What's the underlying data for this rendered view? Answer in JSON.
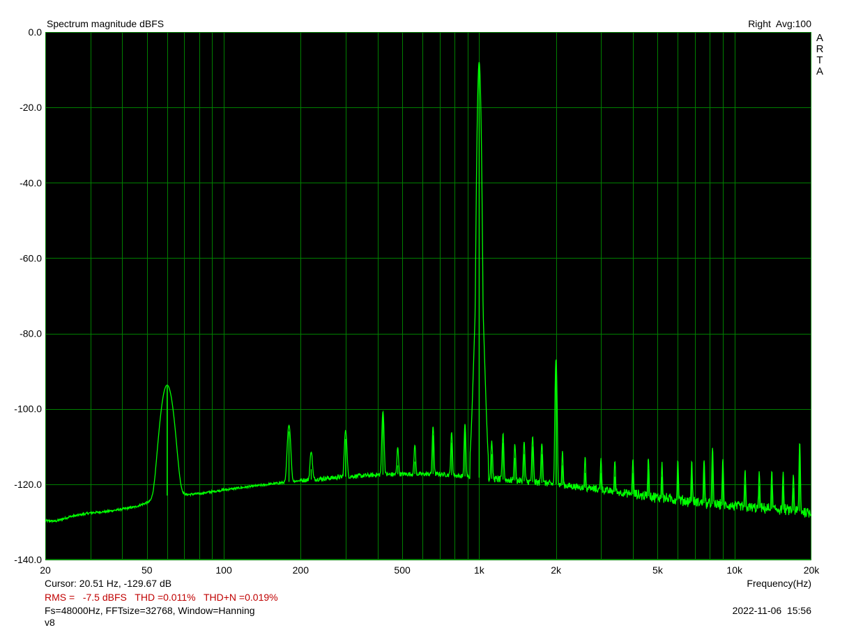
{
  "chart_data": {
    "type": "line",
    "title": "Spectrum magnitude dBFS",
    "channel_info": "Right  Avg:100",
    "logo_letters": [
      "A",
      "R",
      "T",
      "A"
    ],
    "xlabel": "Frequency(Hz)",
    "ylabel": "",
    "x_scale": "log",
    "xlim": [
      20,
      20000
    ],
    "ylim": [
      -140,
      0
    ],
    "x_ticks": [
      {
        "value": 20,
        "label": "20"
      },
      {
        "value": 50,
        "label": "50"
      },
      {
        "value": 100,
        "label": "100"
      },
      {
        "value": 200,
        "label": "200"
      },
      {
        "value": 500,
        "label": "500"
      },
      {
        "value": 1000,
        "label": "1k"
      },
      {
        "value": 2000,
        "label": "2k"
      },
      {
        "value": 5000,
        "label": "5k"
      },
      {
        "value": 10000,
        "label": "10k"
      },
      {
        "value": 20000,
        "label": "20k"
      }
    ],
    "y_ticks": [
      {
        "value": 0,
        "label": "0.0"
      },
      {
        "value": -20,
        "label": "-20.0"
      },
      {
        "value": -40,
        "label": "-40.0"
      },
      {
        "value": -60,
        "label": "-60.0"
      },
      {
        "value": -80,
        "label": "-80.0"
      },
      {
        "value": -100,
        "label": "-100.0"
      },
      {
        "value": -120,
        "label": "-120.0"
      },
      {
        "value": -140,
        "label": "-140.0"
      }
    ],
    "grid": true,
    "background": "#000000",
    "grid_color": "#008000",
    "trace_color": "#00ff00",
    "series": [
      {
        "baseline": [
          [
            20,
            -129.7
          ],
          [
            22,
            -129.8
          ],
          [
            25,
            -128.6
          ],
          [
            30,
            -127.6
          ],
          [
            35,
            -127.2
          ],
          [
            40,
            -126.6
          ],
          [
            45,
            -126.0
          ],
          [
            50,
            -124.9
          ],
          [
            55,
            -124.6
          ],
          [
            57,
            -124.4
          ],
          [
            58,
            -123.0
          ],
          [
            63,
            -123.0
          ],
          [
            70,
            -122.8
          ],
          [
            80,
            -122.5
          ],
          [
            100,
            -121.5
          ],
          [
            150,
            -120.0
          ],
          [
            200,
            -119.0
          ],
          [
            300,
            -118.0
          ],
          [
            400,
            -117.5
          ],
          [
            500,
            -117.3
          ],
          [
            700,
            -117.3
          ],
          [
            1100,
            -118.5
          ],
          [
            1500,
            -119.2
          ],
          [
            2000,
            -120.0
          ],
          [
            3000,
            -121.5
          ],
          [
            5000,
            -123.5
          ],
          [
            8000,
            -125.2
          ],
          [
            12000,
            -126.3
          ],
          [
            16000,
            -126.8
          ],
          [
            20000,
            -127.5
          ]
        ],
        "peaks": [
          {
            "f": 60,
            "db": -94.0,
            "width": 0.028
          },
          {
            "f": 180,
            "db": -106.0,
            "width": 0.008
          },
          {
            "f": 220,
            "db": -116.0,
            "width": 0.006
          },
          {
            "f": 300,
            "db": -108.0,
            "width": 0.006
          },
          {
            "f": 420,
            "db": -102.0,
            "width": 0.005
          },
          {
            "f": 480,
            "db": -115.0,
            "width": 0.004
          },
          {
            "f": 560,
            "db": -114.0,
            "width": 0.004
          },
          {
            "f": 660,
            "db": -107.0,
            "width": 0.004
          },
          {
            "f": 780,
            "db": -109.0,
            "width": 0.004
          },
          {
            "f": 880,
            "db": -106.0,
            "width": 0.004
          },
          {
            "f": 1000,
            "db": -8.0,
            "width": 0.006
          },
          {
            "f": 1120,
            "db": -112.0,
            "width": 0.004
          },
          {
            "f": 1240,
            "db": -109.0,
            "width": 0.004
          },
          {
            "f": 1380,
            "db": -113.0,
            "width": 0.004
          },
          {
            "f": 1500,
            "db": -112.0,
            "width": 0.004
          },
          {
            "f": 1620,
            "db": -110.0,
            "width": 0.004
          },
          {
            "f": 1760,
            "db": -112.0,
            "width": 0.004
          },
          {
            "f": 2000,
            "db": -87.0,
            "width": 0.004
          },
          {
            "f": 2120,
            "db": -115.0,
            "width": 0.003
          },
          {
            "f": 2600,
            "db": -117.0,
            "width": 0.003
          },
          {
            "f": 3000,
            "db": -117.0,
            "width": 0.003
          },
          {
            "f": 3400,
            "db": -118.0,
            "width": 0.003
          },
          {
            "f": 4000,
            "db": -117.0,
            "width": 0.003
          },
          {
            "f": 4600,
            "db": -116.0,
            "width": 0.003
          },
          {
            "f": 5200,
            "db": -118.0,
            "width": 0.003
          },
          {
            "f": 6000,
            "db": -117.0,
            "width": 0.003
          },
          {
            "f": 6800,
            "db": -117.0,
            "width": 0.003
          },
          {
            "f": 7600,
            "db": -116.0,
            "width": 0.003
          },
          {
            "f": 8200,
            "db": -112.0,
            "width": 0.003
          },
          {
            "f": 9000,
            "db": -116.0,
            "width": 0.003
          },
          {
            "f": 11000,
            "db": -120.0,
            "width": 0.003
          },
          {
            "f": 12500,
            "db": -120.5,
            "width": 0.003
          },
          {
            "f": 14000,
            "db": -120.0,
            "width": 0.003
          },
          {
            "f": 15500,
            "db": -120.5,
            "width": 0.003
          },
          {
            "f": 17000,
            "db": -121.0,
            "width": 0.003
          },
          {
            "f": 18000,
            "db": -110.0,
            "width": 0.003
          }
        ]
      }
    ]
  },
  "footer": {
    "cursor": "Cursor: 20.51 Hz, -129.67 dB",
    "measurements": "RMS =   -7.5 dBFS   THD =0.011%   THD+N =0.019%",
    "settings": "Fs=48000Hz, FFTsize=32768, Window=Hanning",
    "version": "v8",
    "timestamp": "2022-11-06  15:56"
  }
}
